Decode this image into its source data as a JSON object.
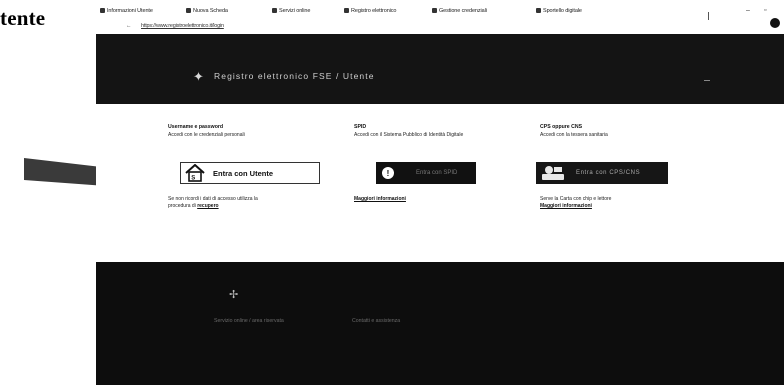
{
  "caption": "tente",
  "browser": {
    "tabs": [
      "Informazioni Utente",
      "Nuova Scheda",
      "Servizi online",
      "Registro elettronico",
      "Gestione credenziali",
      "Sportello digitale"
    ],
    "url": "https://www.registroelettronico.it/login"
  },
  "hero": {
    "title": "Registro elettronico FSE / Utente"
  },
  "options": {
    "utente": {
      "heading": "Username e password",
      "sub": "Accedi con le credenziali personali",
      "button_label": "Entra con Utente",
      "note_line1": "Se non ricordi i dati di accesso utilizza la",
      "note_line2_prefix": "procedura di ",
      "note_link": "recupero"
    },
    "spid": {
      "heading": "SPID",
      "sub": "Accedi con il Sistema Pubblico di Identità Digitale",
      "button_label": "Entra con SPID",
      "link": "Maggiori informazioni"
    },
    "cns": {
      "heading": "CPS oppure CNS",
      "sub": "Accedi con la tessera sanitaria",
      "button_label": "Entra con CPS/CNS",
      "note_line1": "Serve la Carta con chip e lettore",
      "link": "Maggiori informazioni"
    }
  },
  "footer": {
    "text_left": "Servizio online / area riservata",
    "text_right": "Contatti e assistenza"
  }
}
